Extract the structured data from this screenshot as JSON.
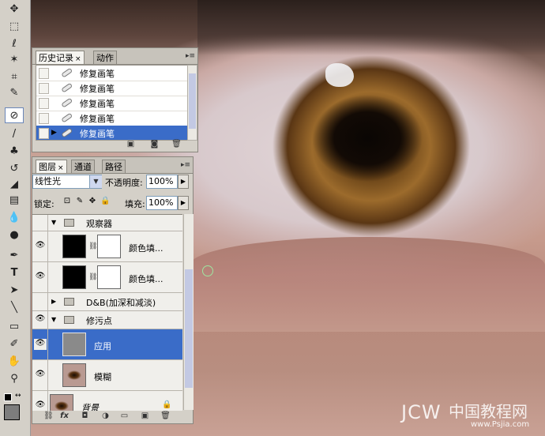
{
  "history_panel": {
    "tabs": [
      {
        "label": "历史记录",
        "close": "×"
      },
      {
        "label": "动作"
      }
    ],
    "items": [
      {
        "label": "修复画笔"
      },
      {
        "label": "修复画笔"
      },
      {
        "label": "修复画笔"
      },
      {
        "label": "修复画笔"
      },
      {
        "label": "修复画笔"
      }
    ]
  },
  "layers_panel": {
    "tabs": [
      {
        "label": "图层",
        "close": "×"
      },
      {
        "label": "通道"
      },
      {
        "label": "路径"
      }
    ],
    "blend_mode": "线性光",
    "opacity_label": "不透明度:",
    "opacity_value": "100%",
    "lock_label": "锁定:",
    "fill_label": "填充:",
    "fill_value": "100%",
    "layers": [
      {
        "name": "观察器",
        "type": "group",
        "visible": false,
        "expanded": true
      },
      {
        "name": "颜色填...",
        "type": "fill",
        "visible": true
      },
      {
        "name": "颜色填...",
        "type": "fill",
        "visible": true
      },
      {
        "name": "D&B(加深和减淡)",
        "type": "group",
        "visible": false,
        "expanded": false
      },
      {
        "name": "修污点",
        "type": "group",
        "visible": true,
        "expanded": true
      },
      {
        "name": "应用",
        "type": "layer",
        "visible": true,
        "selected": true
      },
      {
        "name": "模糊",
        "type": "layer",
        "visible": true
      },
      {
        "name": "背景",
        "type": "background",
        "visible": true,
        "locked": true
      }
    ]
  },
  "watermark": {
    "brand": "JCW",
    "chinese": "中国教程网",
    "url": "www.Psjia.com"
  },
  "colors": {
    "selection": "#3a6cc8",
    "panel_bg": "#d4d0c8",
    "foreground": "#7d7d7d"
  }
}
